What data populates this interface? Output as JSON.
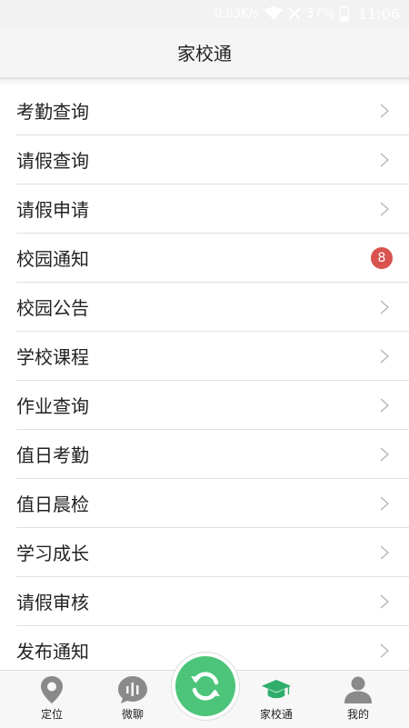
{
  "status_bar": {
    "speed": "0.03K/s",
    "battery": "37%",
    "time": "11:06"
  },
  "header": {
    "title": "家校通"
  },
  "menu": {
    "items": [
      {
        "label": "考勤查询"
      },
      {
        "label": "请假查询"
      },
      {
        "label": "请假申请"
      },
      {
        "label": "校园通知",
        "badge": "8"
      },
      {
        "label": "校园公告"
      },
      {
        "label": "学校课程"
      },
      {
        "label": "作业查询"
      },
      {
        "label": "值日考勤"
      },
      {
        "label": "值日晨检"
      },
      {
        "label": "学习成长"
      },
      {
        "label": "请假审核"
      },
      {
        "label": "发布通知"
      }
    ]
  },
  "tabbar": {
    "tabs": [
      {
        "label": "定位",
        "icon": "location-pin-icon"
      },
      {
        "label": "微聊",
        "icon": "voice-chat-icon"
      },
      {
        "label": "",
        "icon": "refresh-icon"
      },
      {
        "label": "家校通",
        "icon": "graduation-cap-icon",
        "active": true
      },
      {
        "label": "我的",
        "icon": "user-icon"
      }
    ]
  },
  "colors": {
    "accent": "#2fae6b",
    "center_button": "#4cc47a",
    "badge": "#d9534f",
    "icon_gray": "#8a8a8a"
  }
}
